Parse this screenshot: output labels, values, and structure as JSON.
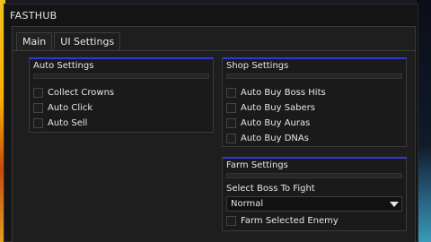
{
  "window": {
    "title": "FASTHUB"
  },
  "tabs": [
    {
      "label": "Main",
      "active": true
    },
    {
      "label": "UI Settings",
      "active": false
    }
  ],
  "auto_settings": {
    "title": "Auto Settings",
    "items": [
      "Collect Crowns",
      "Auto Click",
      "Auto Sell"
    ]
  },
  "shop_settings": {
    "title": "Shop Settings",
    "items": [
      "Auto Buy Boss Hits",
      "Auto Buy Sabers",
      "Auto Buy Auras",
      "Auto Buy DNAs"
    ]
  },
  "farm_settings": {
    "title": "Farm Settings",
    "select_label": "Select Boss To Fight",
    "selected_value": "Normal",
    "toggle_label": "Farm Selected Enemy"
  },
  "colors": {
    "accent": "#2e3ad8",
    "panel": "#1e1e1e",
    "window": "#141414"
  },
  "icons": {
    "dropdown": "triangle-down-icon"
  }
}
